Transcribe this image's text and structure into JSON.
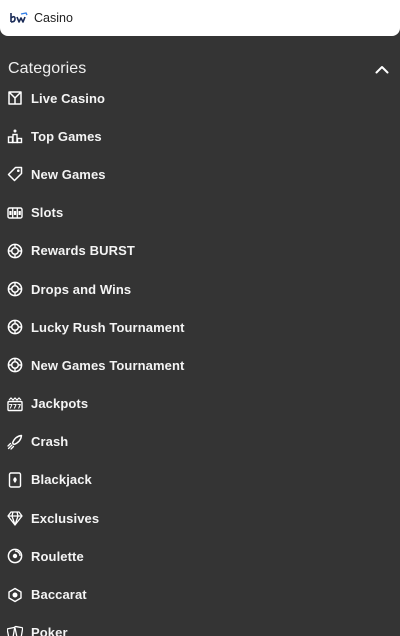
{
  "topbar": {
    "brand_icon": "bw-logo-icon",
    "title": "Casino"
  },
  "categories": {
    "title": "Categories",
    "toggle_icon": "chevron-up-icon",
    "items": [
      {
        "label": "Live Casino",
        "icon": "live-casino-icon"
      },
      {
        "label": "Top Games",
        "icon": "podium-icon"
      },
      {
        "label": "New Games",
        "icon": "tag-icon"
      },
      {
        "label": "Slots",
        "icon": "slot-reels-icon"
      },
      {
        "label": "Rewards BURST",
        "icon": "chip-icon"
      },
      {
        "label": "Drops and Wins",
        "icon": "chip-icon"
      },
      {
        "label": "Lucky Rush Tournament",
        "icon": "chip-icon"
      },
      {
        "label": "New Games Tournament",
        "icon": "chip-icon"
      },
      {
        "label": "Jackpots",
        "icon": "jackpot-icon"
      },
      {
        "label": "Crash",
        "icon": "rocket-icon"
      },
      {
        "label": "Blackjack",
        "icon": "cards-icon"
      },
      {
        "label": "Exclusives",
        "icon": "diamond-icon"
      },
      {
        "label": "Roulette",
        "icon": "roulette-icon"
      },
      {
        "label": "Baccarat",
        "icon": "baccarat-icon"
      },
      {
        "label": "Poker",
        "icon": "poker-icon"
      }
    ]
  },
  "colors": {
    "background": "#343434",
    "topbar": "#ffffff",
    "text": "#f4f4f4"
  }
}
